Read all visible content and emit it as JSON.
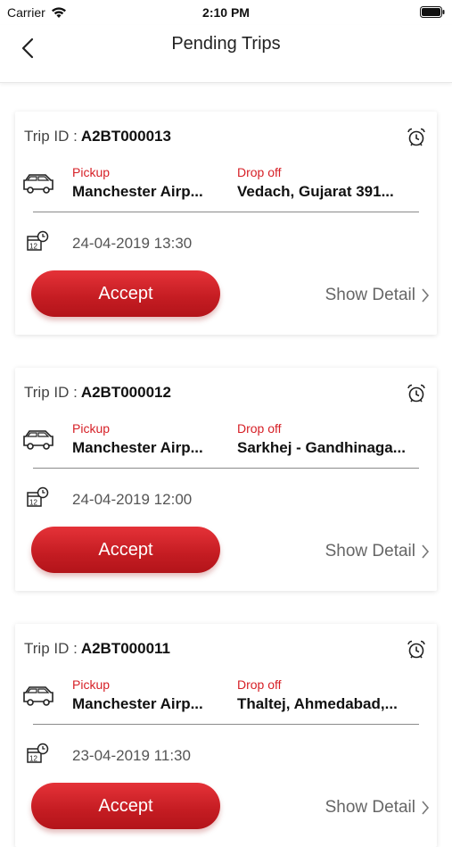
{
  "status": {
    "carrier": "Carrier",
    "time": "2:10 PM"
  },
  "header": {
    "title": "Pending Trips"
  },
  "labels": {
    "trip_id": "Trip ID :",
    "pickup": "Pickup",
    "dropoff": "Drop off",
    "accept": "Accept",
    "show_detail": "Show Detail"
  },
  "trips": [
    {
      "id": "A2BT000013",
      "pickup": "Manchester Airp...",
      "dropoff": "Vedach, Gujarat 391...",
      "datetime": "24-04-2019 13:30"
    },
    {
      "id": "A2BT000012",
      "pickup": "Manchester Airp...",
      "dropoff": "Sarkhej - Gandhinaga...",
      "datetime": "24-04-2019 12:00"
    },
    {
      "id": "A2BT000011",
      "pickup": "Manchester Airp...",
      "dropoff": "Thaltej, Ahmedabad,...",
      "datetime": "23-04-2019 11:30"
    }
  ]
}
